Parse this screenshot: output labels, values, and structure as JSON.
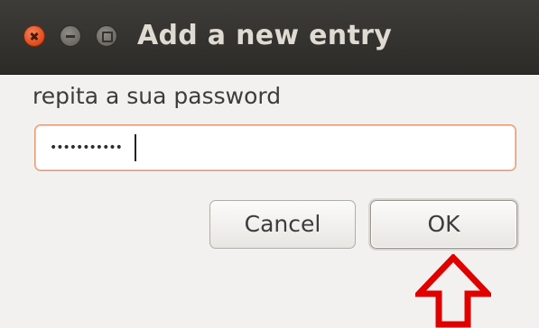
{
  "window": {
    "title": "Add a new entry"
  },
  "titlebar": {
    "buttons": [
      {
        "name": "close-icon",
        "color": "#e0491a"
      },
      {
        "name": "minimize-icon",
        "color": "#6b6963"
      },
      {
        "name": "maximize-icon",
        "color": "#6b6963"
      }
    ]
  },
  "form": {
    "label": "repita a sua password",
    "password_value": "•••••••••••",
    "field_border_color": "#e09a78"
  },
  "actions": {
    "cancel_label": "Cancel",
    "ok_label": "OK"
  },
  "annotation": {
    "icon": "up-arrow-icon",
    "color": "#e00000"
  }
}
